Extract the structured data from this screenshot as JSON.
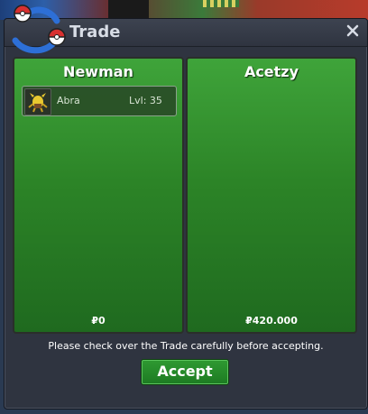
{
  "window": {
    "title": "Trade"
  },
  "left_panel": {
    "player_name": "Newman",
    "items": [
      {
        "name": "Abra",
        "level": "Lvl: 35"
      }
    ],
    "money": "₽0"
  },
  "right_panel": {
    "player_name": "Acetzy",
    "money": "₽420.000"
  },
  "footer": {
    "notice": "Please check over the Trade carefully before accepting.",
    "accept_label": "Accept"
  }
}
